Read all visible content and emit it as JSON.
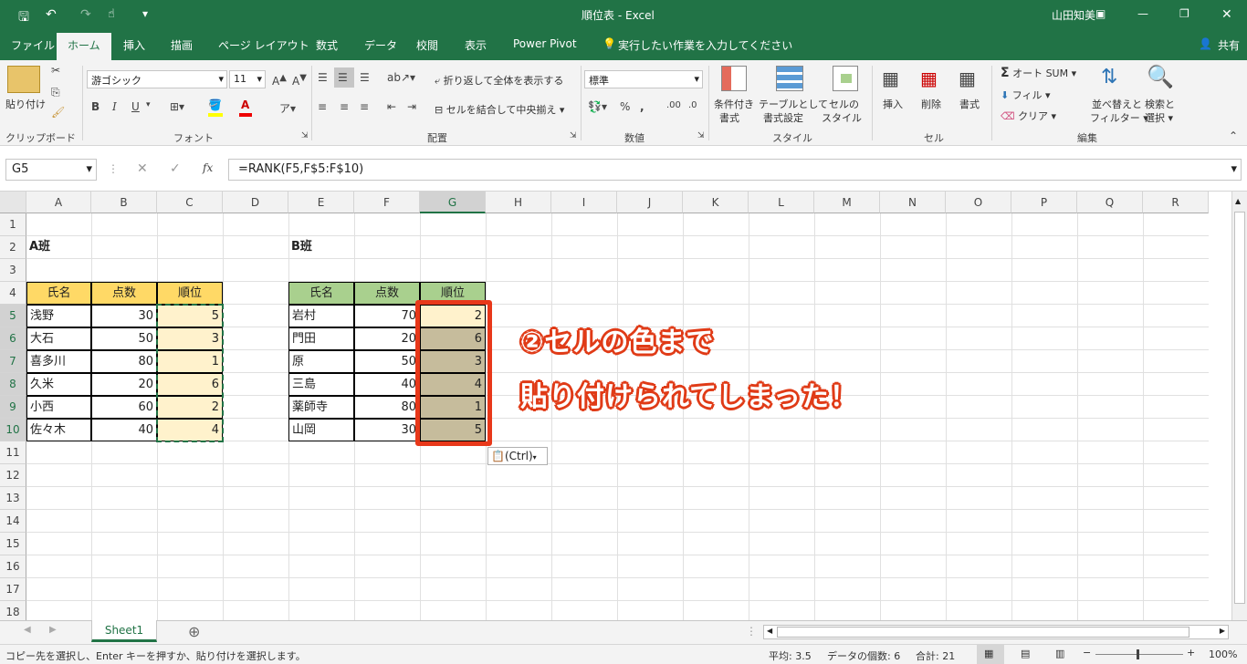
{
  "title_bar": {
    "doc_title": "順位表",
    "app_sep": "-",
    "app_name": "Excel",
    "user": "山田知美"
  },
  "tabs": [
    "ファイル",
    "ホーム",
    "挿入",
    "描画",
    "ページ レイアウト",
    "数式",
    "データ",
    "校閲",
    "表示",
    "Power Pivot"
  ],
  "tell_me": "実行したい作業を入力してください",
  "share": "共有",
  "ribbon": {
    "clipboard": {
      "paste": "貼り付け",
      "group": "クリップボード"
    },
    "font": {
      "name": "游ゴシック",
      "size": "11",
      "group": "フォント",
      "bold": "B",
      "italic": "I",
      "underline": "U"
    },
    "alignment": {
      "wrap": "折り返して全体を表示する",
      "merge": "セルを結合して中央揃え",
      "group": "配置"
    },
    "number": {
      "format": "標準",
      "percent": "%",
      "group": "数値"
    },
    "styles": {
      "conditional": "条件付き\n書式",
      "table": "テーブルとして\n書式設定",
      "cell": "セルの\nスタイル",
      "group": "スタイル",
      "conditional_l1": "条件付き",
      "conditional_l2": "書式",
      "table_l1": "テーブルとして",
      "table_l2": "書式設定",
      "cell_l1": "セルの",
      "cell_l2": "スタイル"
    },
    "cells": {
      "insert": "挿入",
      "delete": "削除",
      "format": "書式",
      "group": "セル"
    },
    "editing": {
      "autosum": "オート SUM",
      "fill": "フィル",
      "clear": "クリア",
      "sort_l1": "並べ替えと",
      "sort_l2": "フィルター",
      "find_l1": "検索と",
      "find_l2": "選択",
      "group": "編集"
    }
  },
  "formula_bar": {
    "name_box": "G5",
    "fx": "fx",
    "formula": "=RANK(F5,F$5:F$10)"
  },
  "columns": [
    "A",
    "B",
    "C",
    "D",
    "E",
    "F",
    "G",
    "H",
    "I",
    "J",
    "K",
    "L",
    "M",
    "N",
    "O",
    "P",
    "Q",
    "R"
  ],
  "rows": [
    "1",
    "2",
    "3",
    "4",
    "5",
    "6",
    "7",
    "8",
    "9",
    "10",
    "11",
    "12",
    "13",
    "14",
    "15",
    "16",
    "17",
    "18"
  ],
  "table_a": {
    "title": "A班",
    "headers": [
      "氏名",
      "点数",
      "順位"
    ],
    "rows": [
      [
        "浅野",
        "30",
        "5"
      ],
      [
        "大石",
        "50",
        "3"
      ],
      [
        "喜多川",
        "80",
        "1"
      ],
      [
        "久米",
        "20",
        "6"
      ],
      [
        "小西",
        "60",
        "2"
      ],
      [
        "佐々木",
        "40",
        "4"
      ]
    ]
  },
  "table_b": {
    "title": "B班",
    "headers": [
      "氏名",
      "点数",
      "順位"
    ],
    "rows": [
      [
        "岩村",
        "70",
        "2"
      ],
      [
        "門田",
        "20",
        "6"
      ],
      [
        "原",
        "50",
        "3"
      ],
      [
        "三島",
        "40",
        "4"
      ],
      [
        "薬師寺",
        "80",
        "1"
      ],
      [
        "山岡",
        "30",
        "5"
      ]
    ]
  },
  "paste_options": "(Ctrl)",
  "annotation": {
    "line1": "②セルの色まで",
    "line2": "貼り付けられてしまった！"
  },
  "sheet_tab": "Sheet1",
  "status": {
    "message": "コピー先を選択し、Enter キーを押すか、貼り付けを選択します。",
    "average": "平均: 3.5",
    "count": "データの個数: 6",
    "sum": "合計: 21",
    "zoom": "100%"
  },
  "colors": {
    "excel_green": "#217346",
    "header_yellow": "#ffd966",
    "rank_fill": "#fff2cc",
    "header_green": "#a9d08e",
    "pasted_fill": "#c6bc9c",
    "highlight_red": "#e8381a"
  }
}
